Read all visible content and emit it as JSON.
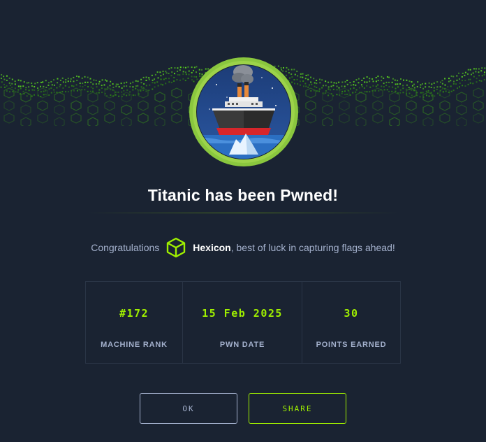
{
  "header": {
    "title": "Titanic has been Pwned!"
  },
  "emblem": {
    "icon": "titanic-ship-icon",
    "ring_color": "#8ac73e"
  },
  "congrats": {
    "prefix": "Congratulations",
    "username": "Hexicon",
    "suffix": ", best of luck in capturing flags ahead!",
    "avatar_icon": "hexagon-cube-icon"
  },
  "stats": [
    {
      "value": "#172",
      "label": "MACHINE RANK"
    },
    {
      "value": "15 Feb 2025",
      "label": "PWN DATE"
    },
    {
      "value": "30",
      "label": "POINTS EARNED"
    }
  ],
  "buttons": {
    "ok_label": "OK",
    "share_label": "SHARE"
  },
  "colors": {
    "background": "#1a2332",
    "accent": "#9fef00",
    "text_muted": "#a4b1cd",
    "title": "#ffffff"
  }
}
